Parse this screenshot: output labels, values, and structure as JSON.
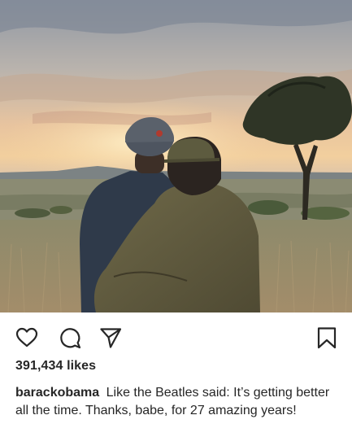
{
  "post": {
    "photo_alt": "Couple embracing while watching a sunset over a savanna",
    "actions": {
      "like_icon": "heart-icon",
      "comment_icon": "comment-icon",
      "share_icon": "send-icon",
      "save_icon": "bookmark-icon"
    },
    "likes": "391,434 likes",
    "caption": {
      "username": "barackobama",
      "text": "Like the Beatles said: It’s getting better all the time. Thanks, babe, for 27 amazing years!"
    }
  },
  "colors": {
    "text": "#262626",
    "background": "#ffffff",
    "icon_stroke": "#262626"
  }
}
